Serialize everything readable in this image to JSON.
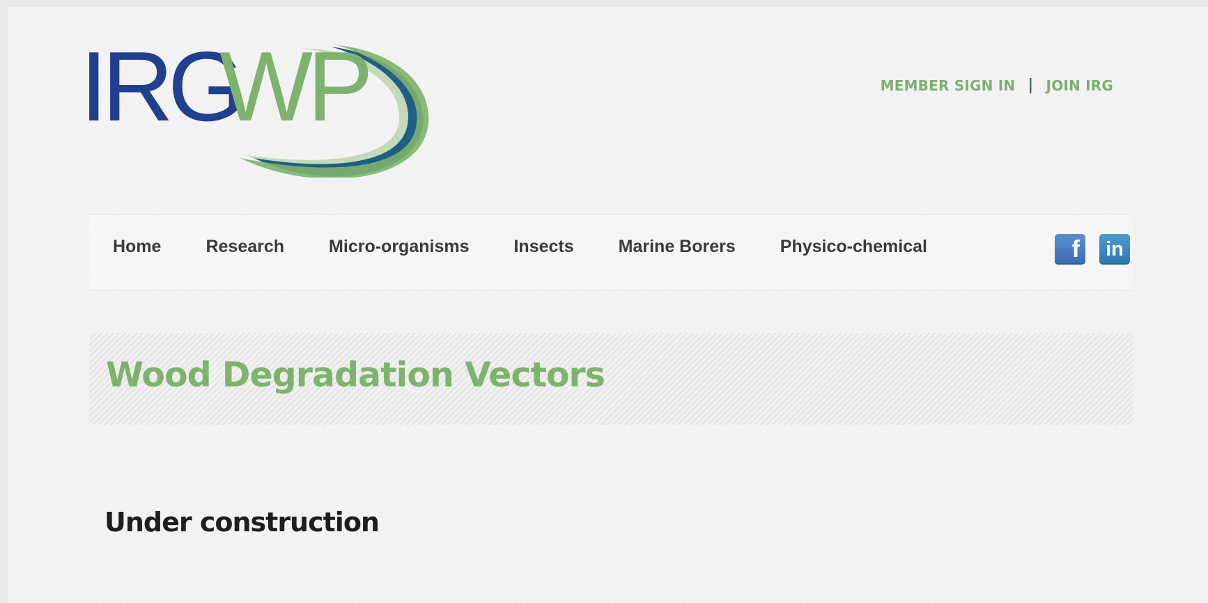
{
  "logo": {
    "text_part1": "IRG",
    "text_part2": "WP",
    "colors": {
      "blue": "#1f3f8f",
      "green": "#7eb36d",
      "teal": "#1f5f86",
      "light_green": "#c3d9b8"
    }
  },
  "top_links": {
    "sign_in": "MEMBER SIGN IN",
    "separator": "|",
    "join": "JOIN IRG"
  },
  "nav": {
    "items": [
      {
        "label": "Home"
      },
      {
        "label": "Research"
      },
      {
        "label": "Micro-organisms"
      },
      {
        "label": "Insects"
      },
      {
        "label": "Marine Borers"
      },
      {
        "label": "Physico-chemical"
      }
    ],
    "social": {
      "facebook": {
        "icon": "facebook-icon",
        "glyph": "f"
      },
      "linkedin": {
        "icon": "linkedin-icon",
        "glyph": "in"
      }
    }
  },
  "page": {
    "title": "Wood Degradation Vectors",
    "heading": "Under construction"
  },
  "colors": {
    "accent_green": "#7eb36d",
    "nav_text": "#3a3a3a",
    "background": "#f2f2f2"
  }
}
